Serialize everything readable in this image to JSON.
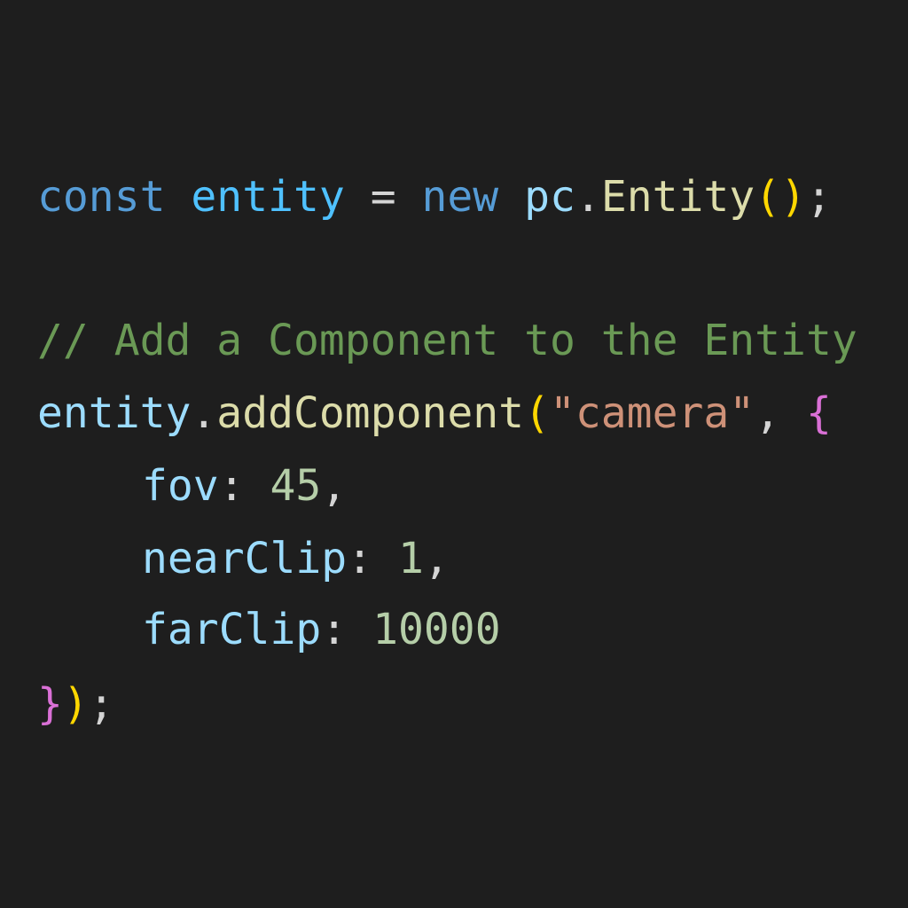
{
  "editor": {
    "theme_colors": {
      "background": "#1e1e1e",
      "keyword": "#569cd6",
      "variable": "#4fc1ff",
      "property": "#9cdcfe",
      "function": "#dcdcaa",
      "string": "#ce9178",
      "number": "#b5cea8",
      "comment": "#6a9955",
      "bracket": "#ffd700",
      "bracket_nested": "#da70d6",
      "punctuation": "#d4d4d4"
    },
    "lines": {
      "l1": {
        "kw_const": "const",
        "sp1": " ",
        "var_entity": "entity",
        "op_eq": " = ",
        "kw_new": "new",
        "sp2": " ",
        "ns_pc": "pc",
        "dot": ".",
        "class_entity": "Entity",
        "paren_open": "(",
        "paren_close": ")",
        "semi": ";"
      },
      "l3": {
        "comment": "// Add a Component to the Entity"
      },
      "l4": {
        "obj": "entity",
        "dot": ".",
        "method": "addComponent",
        "paren_open": "(",
        "string": "\"camera\"",
        "comma": ", ",
        "brace_open": "{"
      },
      "l5": {
        "prop": "fov",
        "colon": ": ",
        "value": "45",
        "comma": ","
      },
      "l6": {
        "prop": "nearClip",
        "colon": ": ",
        "value": "1",
        "comma": ","
      },
      "l7": {
        "prop": "farClip",
        "colon": ": ",
        "value": "10000"
      },
      "l8": {
        "brace_close": "}",
        "paren_close": ")",
        "semi": ";"
      }
    }
  }
}
